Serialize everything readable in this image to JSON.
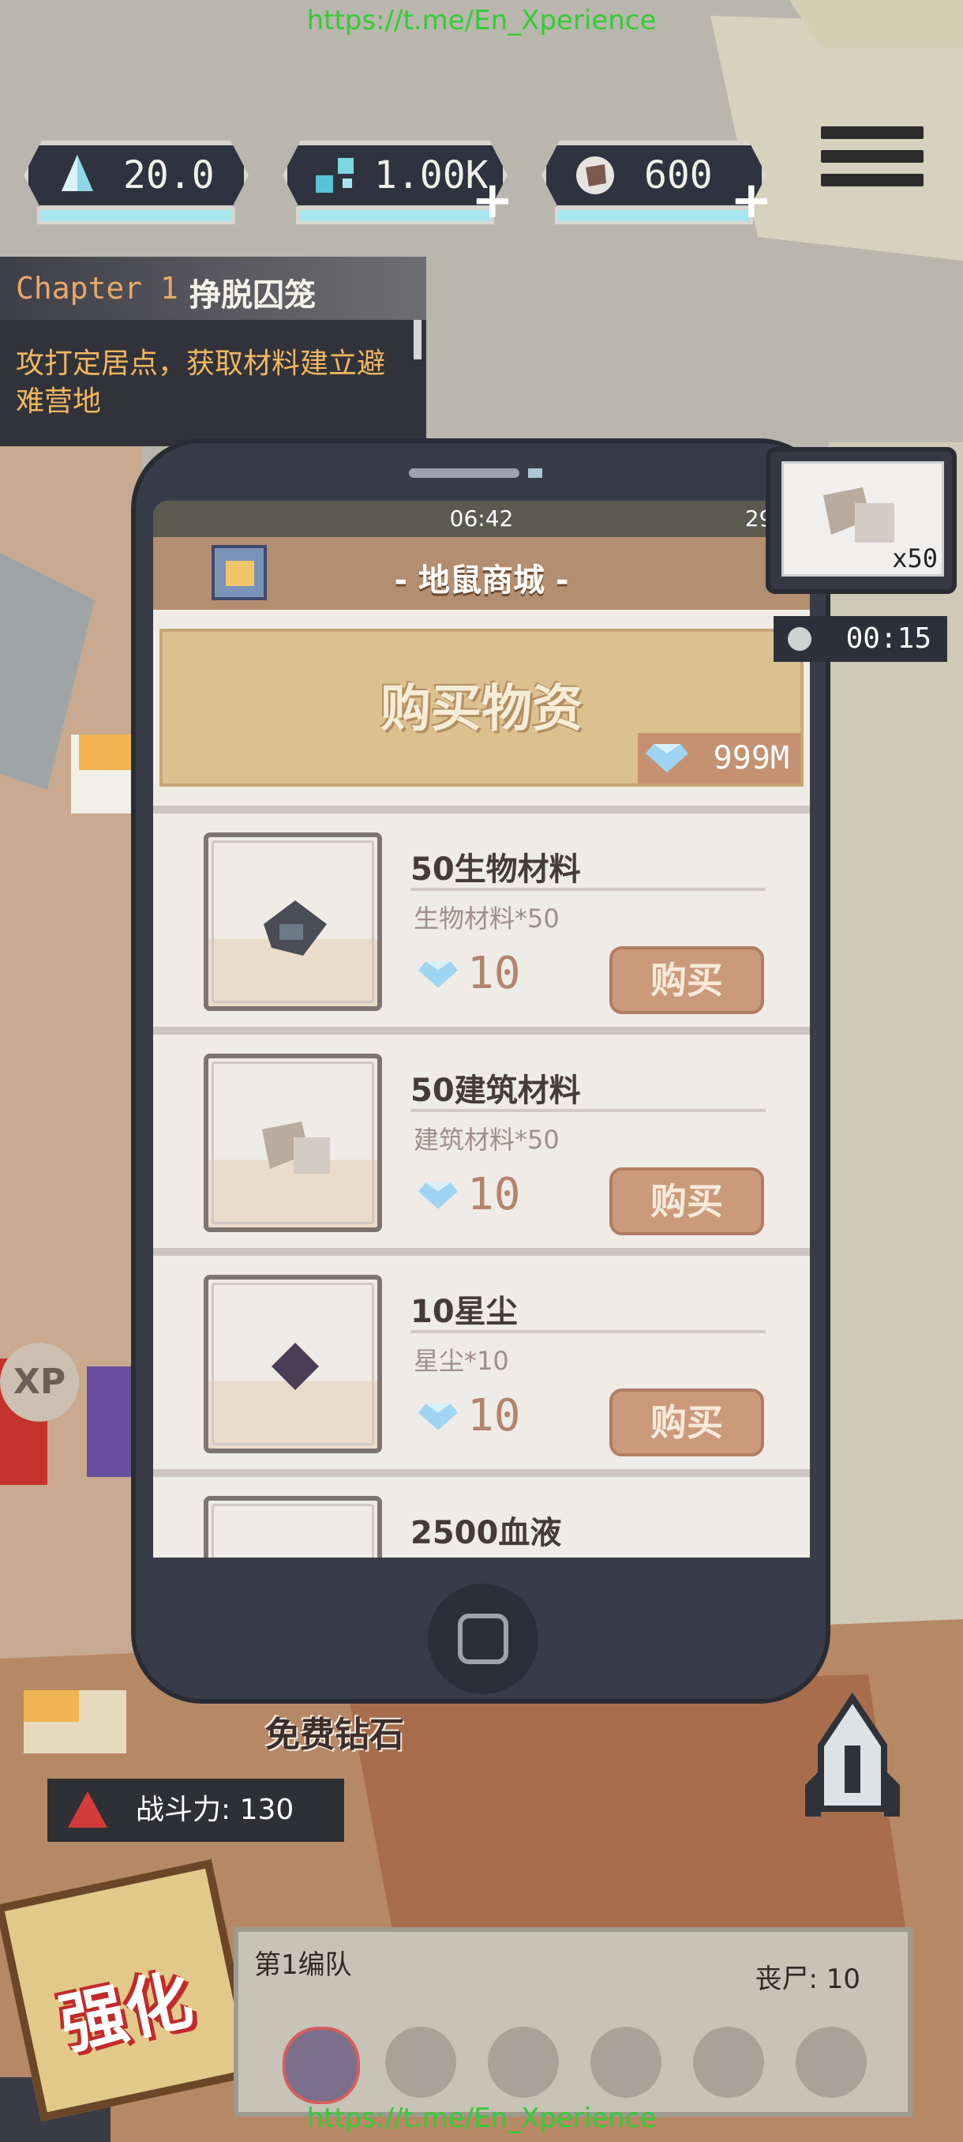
{
  "watermark": {
    "top": "https://t.me/En_Xperience",
    "bottom": "https://t.me/En_Xperience"
  },
  "resources": [
    {
      "icon": "crystal-icon",
      "value": "20.0",
      "plus": false
    },
    {
      "icon": "blue-cells-icon",
      "value": "1.00K",
      "plus": true
    },
    {
      "icon": "ore-icon",
      "value": "600",
      "plus": true
    }
  ],
  "chapter": {
    "number": "Chapter 1",
    "name": "挣脱囚笼",
    "description": "攻打定居点，获取材料建立避难营地"
  },
  "phone": {
    "status_time": "06:42",
    "status_right": "29%",
    "shop_title": "- 地鼠商城 -",
    "banner_title": "购买物资",
    "gem_balance": "999M",
    "items": [
      {
        "name": "50生物材料",
        "sub": "生物材料*50",
        "price": "10",
        "buy": "购买",
        "icon": "bio-material-icon"
      },
      {
        "name": "50建筑材料",
        "sub": "建筑材料*50",
        "price": "10",
        "buy": "购买",
        "icon": "stone-material-icon"
      },
      {
        "name": "10星尘",
        "sub": "星尘*10",
        "price": "10",
        "buy": "购买",
        "icon": "stardust-icon"
      },
      {
        "name": "2500血液",
        "sub": "",
        "price": "",
        "buy": "",
        "icon": "blood-icon"
      }
    ]
  },
  "production": {
    "multiplier": "x50",
    "timer": "00:15"
  },
  "free_gems": "免费钻石",
  "power": {
    "label": "战斗力: 130"
  },
  "strengthen": "强化",
  "xp": "XP",
  "squad": {
    "name": "第1编队",
    "zombie_count": "丧尸: 10"
  },
  "colors": {
    "accent_gold": "#dcc190",
    "buy_button": "#cb9a7c",
    "phone_body": "#393c48",
    "watermark": "#33cc33"
  }
}
